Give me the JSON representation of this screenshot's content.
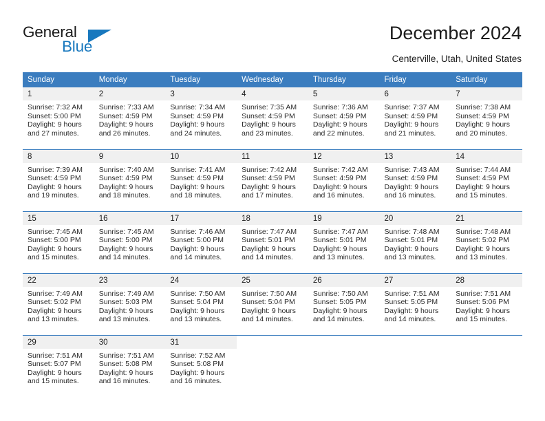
{
  "brand": {
    "name_top": "General",
    "name_bottom": "Blue",
    "accent_color": "#1878be"
  },
  "header": {
    "title": "December 2024",
    "subtitle": "Centerville, Utah, United States"
  },
  "theme": {
    "header_blue": "#3b7dbf",
    "daynum_gray": "#f0f0f0",
    "text": "#1b1b1b"
  },
  "weekdays": [
    "Sunday",
    "Monday",
    "Tuesday",
    "Wednesday",
    "Thursday",
    "Friday",
    "Saturday"
  ],
  "weeks": [
    [
      {
        "day": "1",
        "sunrise": "Sunrise: 7:32 AM",
        "sunset": "Sunset: 5:00 PM",
        "daylight": "Daylight: 9 hours and 27 minutes."
      },
      {
        "day": "2",
        "sunrise": "Sunrise: 7:33 AM",
        "sunset": "Sunset: 4:59 PM",
        "daylight": "Daylight: 9 hours and 26 minutes."
      },
      {
        "day": "3",
        "sunrise": "Sunrise: 7:34 AM",
        "sunset": "Sunset: 4:59 PM",
        "daylight": "Daylight: 9 hours and 24 minutes."
      },
      {
        "day": "4",
        "sunrise": "Sunrise: 7:35 AM",
        "sunset": "Sunset: 4:59 PM",
        "daylight": "Daylight: 9 hours and 23 minutes."
      },
      {
        "day": "5",
        "sunrise": "Sunrise: 7:36 AM",
        "sunset": "Sunset: 4:59 PM",
        "daylight": "Daylight: 9 hours and 22 minutes."
      },
      {
        "day": "6",
        "sunrise": "Sunrise: 7:37 AM",
        "sunset": "Sunset: 4:59 PM",
        "daylight": "Daylight: 9 hours and 21 minutes."
      },
      {
        "day": "7",
        "sunrise": "Sunrise: 7:38 AM",
        "sunset": "Sunset: 4:59 PM",
        "daylight": "Daylight: 9 hours and 20 minutes."
      }
    ],
    [
      {
        "day": "8",
        "sunrise": "Sunrise: 7:39 AM",
        "sunset": "Sunset: 4:59 PM",
        "daylight": "Daylight: 9 hours and 19 minutes."
      },
      {
        "day": "9",
        "sunrise": "Sunrise: 7:40 AM",
        "sunset": "Sunset: 4:59 PM",
        "daylight": "Daylight: 9 hours and 18 minutes."
      },
      {
        "day": "10",
        "sunrise": "Sunrise: 7:41 AM",
        "sunset": "Sunset: 4:59 PM",
        "daylight": "Daylight: 9 hours and 18 minutes."
      },
      {
        "day": "11",
        "sunrise": "Sunrise: 7:42 AM",
        "sunset": "Sunset: 4:59 PM",
        "daylight": "Daylight: 9 hours and 17 minutes."
      },
      {
        "day": "12",
        "sunrise": "Sunrise: 7:42 AM",
        "sunset": "Sunset: 4:59 PM",
        "daylight": "Daylight: 9 hours and 16 minutes."
      },
      {
        "day": "13",
        "sunrise": "Sunrise: 7:43 AM",
        "sunset": "Sunset: 4:59 PM",
        "daylight": "Daylight: 9 hours and 16 minutes."
      },
      {
        "day": "14",
        "sunrise": "Sunrise: 7:44 AM",
        "sunset": "Sunset: 4:59 PM",
        "daylight": "Daylight: 9 hours and 15 minutes."
      }
    ],
    [
      {
        "day": "15",
        "sunrise": "Sunrise: 7:45 AM",
        "sunset": "Sunset: 5:00 PM",
        "daylight": "Daylight: 9 hours and 15 minutes."
      },
      {
        "day": "16",
        "sunrise": "Sunrise: 7:45 AM",
        "sunset": "Sunset: 5:00 PM",
        "daylight": "Daylight: 9 hours and 14 minutes."
      },
      {
        "day": "17",
        "sunrise": "Sunrise: 7:46 AM",
        "sunset": "Sunset: 5:00 PM",
        "daylight": "Daylight: 9 hours and 14 minutes."
      },
      {
        "day": "18",
        "sunrise": "Sunrise: 7:47 AM",
        "sunset": "Sunset: 5:01 PM",
        "daylight": "Daylight: 9 hours and 14 minutes."
      },
      {
        "day": "19",
        "sunrise": "Sunrise: 7:47 AM",
        "sunset": "Sunset: 5:01 PM",
        "daylight": "Daylight: 9 hours and 13 minutes."
      },
      {
        "day": "20",
        "sunrise": "Sunrise: 7:48 AM",
        "sunset": "Sunset: 5:01 PM",
        "daylight": "Daylight: 9 hours and 13 minutes."
      },
      {
        "day": "21",
        "sunrise": "Sunrise: 7:48 AM",
        "sunset": "Sunset: 5:02 PM",
        "daylight": "Daylight: 9 hours and 13 minutes."
      }
    ],
    [
      {
        "day": "22",
        "sunrise": "Sunrise: 7:49 AM",
        "sunset": "Sunset: 5:02 PM",
        "daylight": "Daylight: 9 hours and 13 minutes."
      },
      {
        "day": "23",
        "sunrise": "Sunrise: 7:49 AM",
        "sunset": "Sunset: 5:03 PM",
        "daylight": "Daylight: 9 hours and 13 minutes."
      },
      {
        "day": "24",
        "sunrise": "Sunrise: 7:50 AM",
        "sunset": "Sunset: 5:04 PM",
        "daylight": "Daylight: 9 hours and 13 minutes."
      },
      {
        "day": "25",
        "sunrise": "Sunrise: 7:50 AM",
        "sunset": "Sunset: 5:04 PM",
        "daylight": "Daylight: 9 hours and 14 minutes."
      },
      {
        "day": "26",
        "sunrise": "Sunrise: 7:50 AM",
        "sunset": "Sunset: 5:05 PM",
        "daylight": "Daylight: 9 hours and 14 minutes."
      },
      {
        "day": "27",
        "sunrise": "Sunrise: 7:51 AM",
        "sunset": "Sunset: 5:05 PM",
        "daylight": "Daylight: 9 hours and 14 minutes."
      },
      {
        "day": "28",
        "sunrise": "Sunrise: 7:51 AM",
        "sunset": "Sunset: 5:06 PM",
        "daylight": "Daylight: 9 hours and 15 minutes."
      }
    ],
    [
      {
        "day": "29",
        "sunrise": "Sunrise: 7:51 AM",
        "sunset": "Sunset: 5:07 PM",
        "daylight": "Daylight: 9 hours and 15 minutes."
      },
      {
        "day": "30",
        "sunrise": "Sunrise: 7:51 AM",
        "sunset": "Sunset: 5:08 PM",
        "daylight": "Daylight: 9 hours and 16 minutes."
      },
      {
        "day": "31",
        "sunrise": "Sunrise: 7:52 AM",
        "sunset": "Sunset: 5:08 PM",
        "daylight": "Daylight: 9 hours and 16 minutes."
      },
      {
        "day": "",
        "sunrise": "",
        "sunset": "",
        "daylight": ""
      },
      {
        "day": "",
        "sunrise": "",
        "sunset": "",
        "daylight": ""
      },
      {
        "day": "",
        "sunrise": "",
        "sunset": "",
        "daylight": ""
      },
      {
        "day": "",
        "sunrise": "",
        "sunset": "",
        "daylight": ""
      }
    ]
  ]
}
